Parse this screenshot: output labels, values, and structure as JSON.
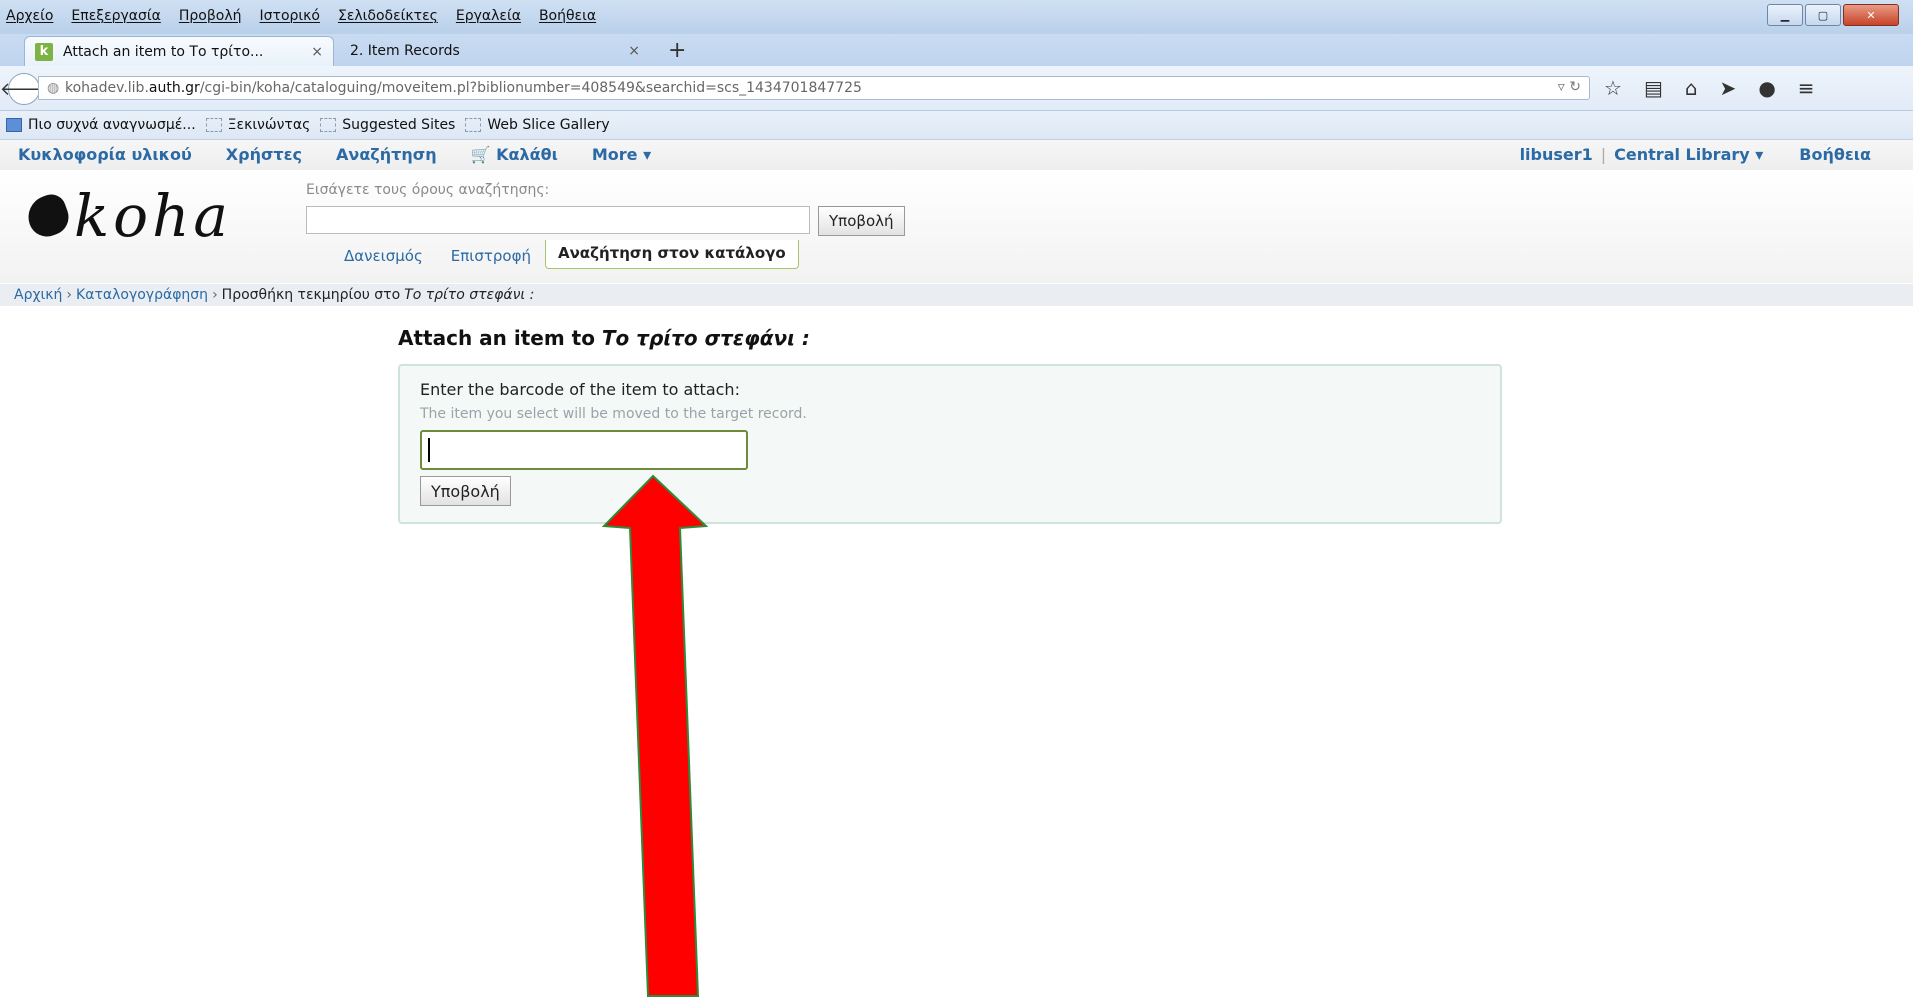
{
  "browser": {
    "menu": [
      "Αρχείο",
      "Επεξεργασία",
      "Προβολή",
      "Ιστορικό",
      "Σελιδοδείκτες",
      "Εργαλεία",
      "Βοήθεια"
    ],
    "tabs": [
      {
        "label": "Attach an item to Το τρίτο...",
        "close": "×",
        "favicon": "k"
      },
      {
        "label": "2. Item Records",
        "close": "×"
      }
    ],
    "new_tab": "+",
    "url": {
      "prefix": "kohadev.lib.",
      "host": "auth.gr",
      "path": "/cgi-bin/koha/cataloguing/moveitem.pl?biblionumber=408549&searchid=scs_1434701847725"
    },
    "bookmarks": [
      "Πιο συχνά αναγνωσμέ...",
      "Ξεκινώντας",
      "Suggested Sites",
      "Web Slice Gallery"
    ]
  },
  "koha_nav": {
    "left": [
      "Κυκλοφορία υλικού",
      "Χρήστες",
      "Αναζήτηση",
      "Καλάθι",
      "More"
    ],
    "user": "libuser1",
    "branch": "Central Library",
    "help": "Βοήθεια"
  },
  "header": {
    "logo": "koha",
    "search_label": "Εισάγετε τους όρους αναζήτησης:",
    "submit": "Υποβολή",
    "tabs": [
      "Δανεισμός",
      "Επιστροφή",
      "Αναζήτηση στον κατάλογο"
    ]
  },
  "breadcrumbs": {
    "home": "Αρχική",
    "cataloging": "Καταλογογράφηση",
    "current": "Προσθήκη τεκμηρίου στο",
    "record": "Το τρίτο στεφάνι :"
  },
  "main": {
    "title_prefix": "Attach an item to",
    "title_record": "Το τρίτο στεφάνι :",
    "barcode_label": "Enter the barcode of the item to attach:",
    "hint": "The item you select will be moved to the target record.",
    "barcode_value": "",
    "submit": "Υποβολή"
  },
  "colors": {
    "link": "#2b6aa4",
    "input_border": "#6d8b3b",
    "arrow_fill": "#ff0000",
    "arrow_stroke": "#2e8b3a"
  },
  "icons": [
    "back-arrow-icon",
    "globe-icon",
    "reload-icon",
    "star-icon",
    "reading-list-icon",
    "home-icon",
    "send-icon",
    "chat-icon",
    "menu-icon",
    "cart-icon",
    "chevron-down-icon"
  ]
}
